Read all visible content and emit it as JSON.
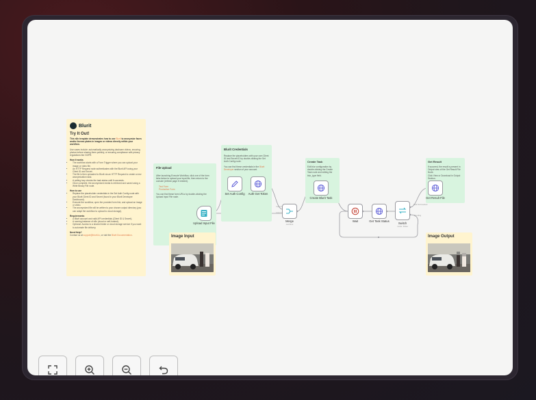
{
  "intro": {
    "brand": "Blurit",
    "title": "Try It Out!",
    "lead_a": "This n8n template demonstrates how to use ",
    "lead_link": "Blurit",
    "lead_b": " to anonymize faces and/or license plates in images or videos directly within your workflow.",
    "usecases": "Use cases include: automatically anonymizing dashcam videos, securing photos before sharing them publicly, or ensuring compliance with privacy regulations like GDPR.",
    "how_works_title": "How it works",
    "how_works": [
      "The workflow starts with a Form Trigger where you can upload your image or video file.",
      "An HTTP Request node authenticates with the Blurit API using your Client ID and Secret.",
      "The file is then uploaded to Blurit via an HTTP Request to create a new anonymization task.",
      "A polling loop checks the task status until it succeeds.",
      "Once complete, the anonymized media is retrieved and saved using a Write Binary File node."
    ],
    "how_use_title": "How to use",
    "how_use": [
      "Replace the placeholder credentials in the Set Auth Config node with your Blurit Client ID and Secret (found in your Blurit Developer Dashboard).",
      "Execute the workflow, open the provided form link, and upload an image or video.",
      "The anonymized file will be written to your chosen output directory (you can adapt the workflow to upload to cloud storage)."
    ],
    "req_title": "Requirements",
    "requirements": [
      "A Blurit account and valid API credentials (Client ID & Secret).",
      "A running instance of n8n (cloud or self-hosted).",
      "Optional: Access to a shared folder or cloud storage service if you want to automate file delivery."
    ],
    "help_title": "Need Help?",
    "help_a": "Contact us at ",
    "help_link1": "support@blurit.io",
    "help_b": ", or visit the ",
    "help_link2": "Blurit Documentation",
    "help_c": "."
  },
  "file_upload": {
    "title": "File Upload",
    "p1": "After launching Execute Workflow, click one of the form links below to upload your input file, then return to the console (refresh page if needed).",
    "link1": "Test Form",
    "link2": "Production Form",
    "p2": "You can find these form URLs by double-clicking the Upload Input File node."
  },
  "credentials": {
    "title": "Blurit Credentials",
    "p1": "Replace the placeholders with your own Client ID and Secret ID by double-clicking the Set Auth Config node.",
    "p2a": "You can find these credentials in the ",
    "p2link": "Blurit Developer",
    "p2b": " section of your account."
  },
  "create_task_note": {
    "title": "Create Task",
    "p1": "Edit blur configuration by double-clicking the Create Task node and editing the blur_type field."
  },
  "get_result_note": {
    "title": "Get Result",
    "p1": "If succeed, the result is present in Output view of the Get Result File Node.",
    "p2": "Click View or Download in Output Section."
  },
  "nodes": {
    "upload": "Upload Input File",
    "set_auth": "Set Auth Config",
    "auth_token": "Auth Get Token",
    "merge": "Merge",
    "merge_sub": "combine",
    "create_task": "Create Blurit Task",
    "wait": "Wait",
    "task_status": "Get Task Status",
    "switch": "Switch",
    "switch_sub": "mode: Rules",
    "get_result": "Get Result File"
  },
  "edges": {
    "input1": "Input 1",
    "input2": "Input 2",
    "succeeded": "Task Succeeded",
    "pending": "Pending"
  },
  "images": {
    "input_title": "Image Input",
    "output_title": "Image Output"
  },
  "controls": {
    "fit": "fit-view-icon",
    "zoom_in": "zoom-in-icon",
    "zoom_out": "zoom-out-icon",
    "reset": "undo-icon"
  }
}
